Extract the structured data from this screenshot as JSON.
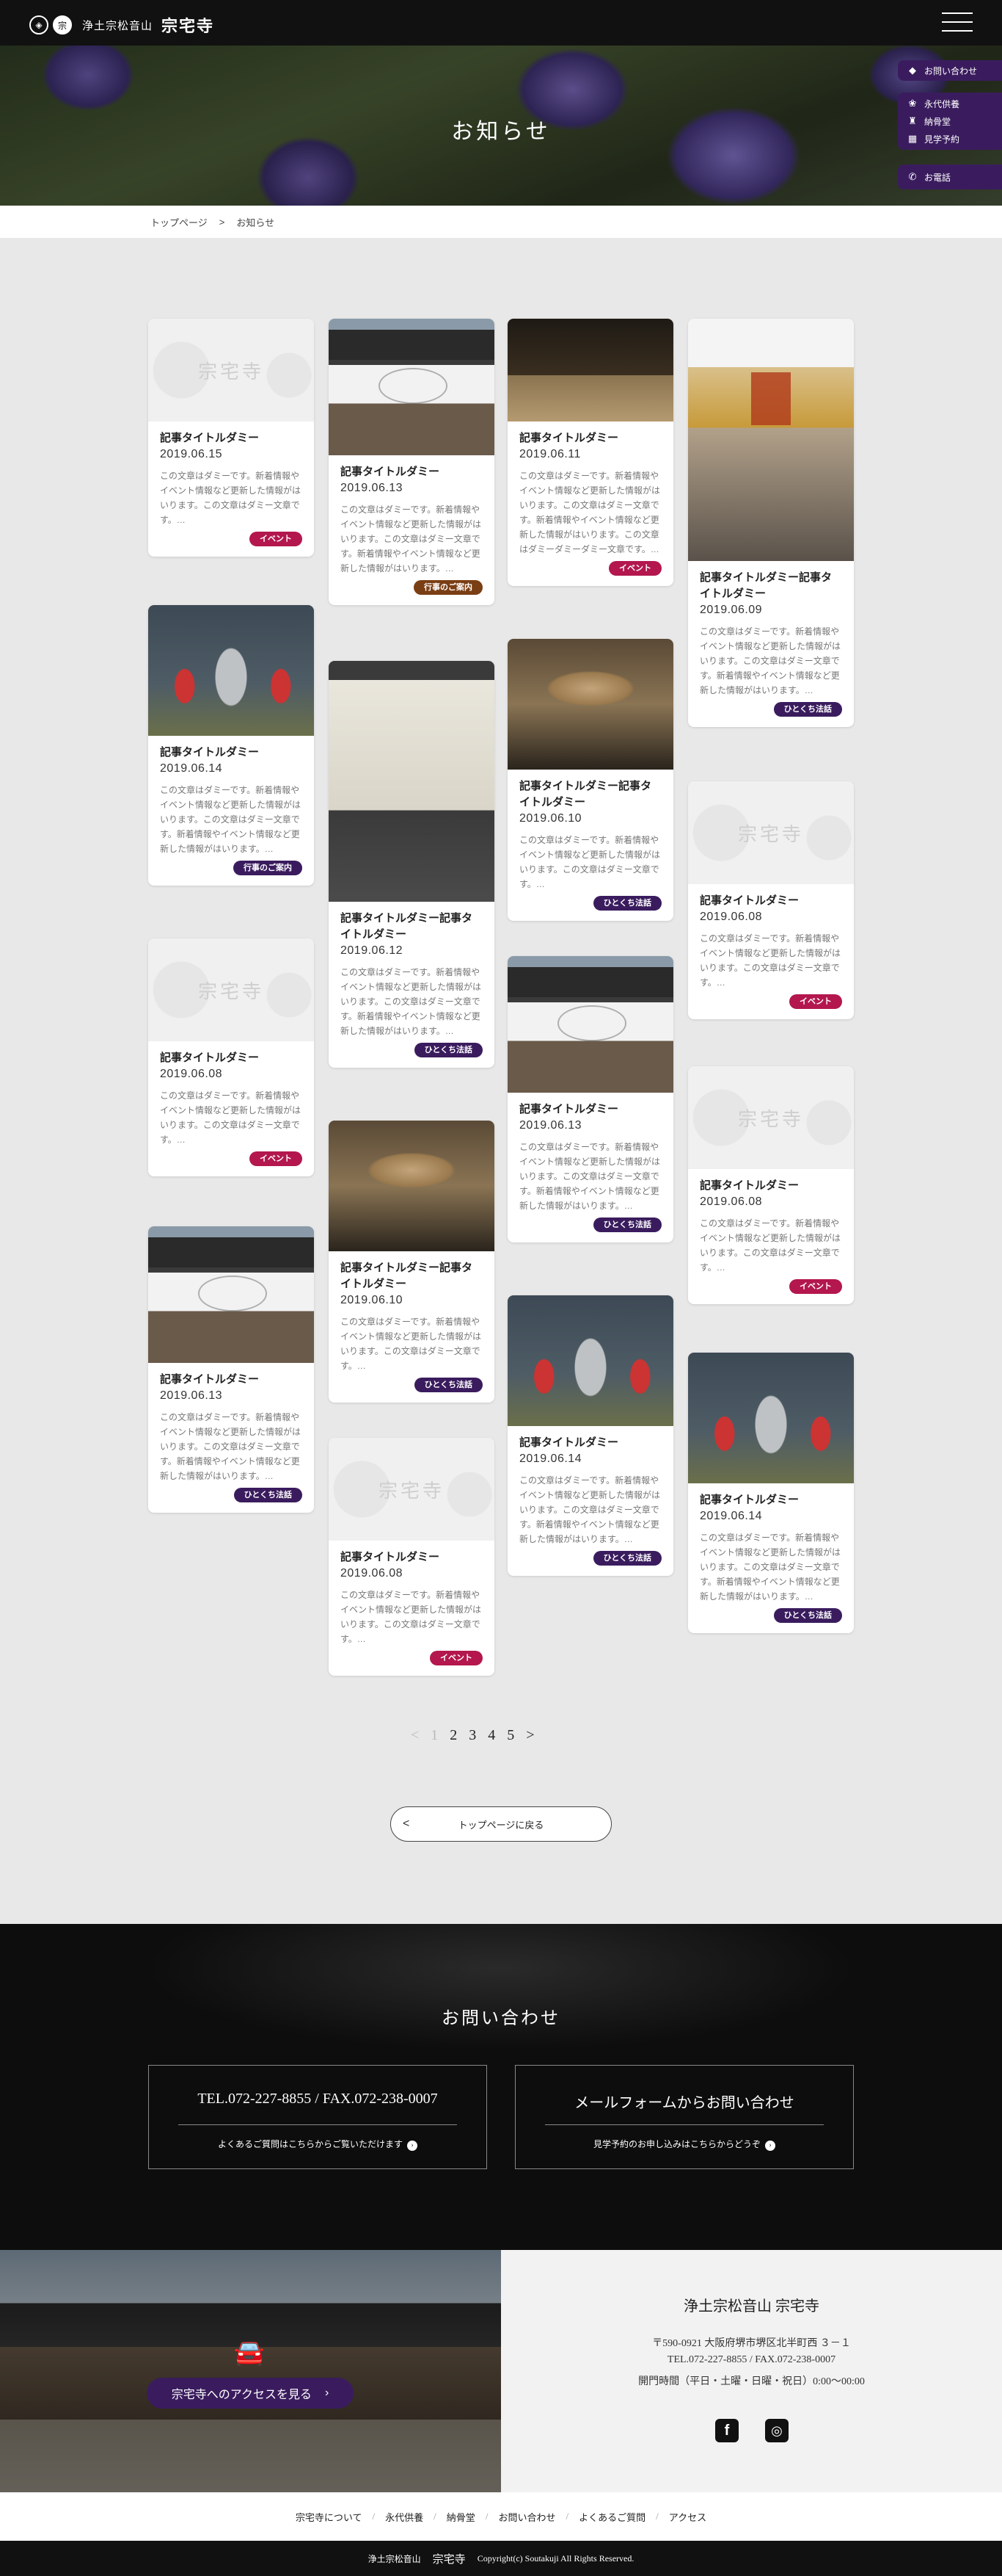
{
  "header": {
    "logo_small": "浄土宗松音山",
    "logo_big": "宗宅寺",
    "crest_text": "宗"
  },
  "side_menu": {
    "contact": "お問い合わせ",
    "items": [
      "永代供養",
      "納骨堂",
      "見学予約"
    ],
    "phone": "お電話"
  },
  "hero": {
    "title": "お知らせ"
  },
  "breadcrumb": {
    "home": "トップページ",
    "sep": ">",
    "current": "お知らせ"
  },
  "thumb_logo_text": "宗宅寺",
  "cards": [
    {
      "title": "記事タイトルダミー",
      "date": "2019.06.15",
      "excerpt": "この文章はダミーです。新着情報やイベント情報など更新した情報がはいります。この文章はダミー文章です。…",
      "tag": "イベント",
      "tag_color": "#b3174d"
    },
    {
      "title": "記事タイトルダミー",
      "date": "2019.06.14",
      "excerpt": "この文章はダミーです。新着情報やイベント情報など更新した情報がはいります。この文章はダミー文章です。新着情報やイベント情報など更新した情報がはいります。…",
      "tag": "行事のご案内",
      "tag_color": "#3a1c5e"
    },
    {
      "title": "記事タイトルダミー",
      "date": "2019.06.08",
      "excerpt": "この文章はダミーです。新着情報やイベント情報など更新した情報がはいります。この文章はダミー文章です。…",
      "tag": "イベント",
      "tag_color": "#b3174d"
    },
    {
      "title": "記事タイトルダミー",
      "date": "2019.06.13",
      "excerpt": "この文章はダミーです。新着情報やイベント情報など更新した情報がはいります。この文章はダミー文章です。新着情報やイベント情報など更新した情報がはいります。…",
      "tag": "ひとくち法話",
      "tag_color": "#3a1c5e"
    },
    {
      "title": "記事タイトルダミー",
      "date": "2019.06.13",
      "excerpt": "この文章はダミーです。新着情報やイベント情報など更新した情報がはいります。この文章はダミー文章です。新着情報やイベント情報など更新した情報がはいります。…",
      "tag": "行事のご案内",
      "tag_color": "#7a3e14"
    },
    {
      "title": "記事タイトルダミー記事タイトルダミー",
      "date": "2019.06.12",
      "excerpt": "この文章はダミーです。新着情報やイベント情報など更新した情報がはいります。この文章はダミー文章です。新着情報やイベント情報など更新した情報がはいります。…",
      "tag": "ひとくち法話",
      "tag_color": "#3a1c5e"
    },
    {
      "title": "記事タイトルダミー記事タイトルダミー",
      "date": "2019.06.10",
      "excerpt": "この文章はダミーです。新着情報やイベント情報など更新した情報がはいります。この文章はダミー文章です。…",
      "tag": "ひとくち法話",
      "tag_color": "#3a1c5e"
    },
    {
      "title": "記事タイトルダミー",
      "date": "2019.06.08",
      "excerpt": "この文章はダミーです。新着情報やイベント情報など更新した情報がはいります。この文章はダミー文章です。…",
      "tag": "イベント",
      "tag_color": "#b3174d"
    },
    {
      "title": "記事タイトルダミー",
      "date": "2019.06.11",
      "excerpt": "この文章はダミーです。新着情報やイベント情報など更新した情報がはいります。この文章はダミー文章です。新着情報やイベント情報など更新した情報がはいります。この文章はダミーダミーダミー文章です。…",
      "tag": "イベント",
      "tag_color": "#b3174d"
    },
    {
      "title": "記事タイトルダミー記事タイトルダミー",
      "date": "2019.06.10",
      "excerpt": "この文章はダミーです。新着情報やイベント情報など更新した情報がはいります。この文章はダミー文章です。…",
      "tag": "ひとくち法話",
      "tag_color": "#3a1c5e"
    },
    {
      "title": "記事タイトルダミー",
      "date": "2019.06.13",
      "excerpt": "この文章はダミーです。新着情報やイベント情報など更新した情報がはいります。この文章はダミー文章です。新着情報やイベント情報など更新した情報がはいります。…",
      "tag": "ひとくち法話",
      "tag_color": "#3a1c5e"
    },
    {
      "title": "記事タイトルダミー",
      "date": "2019.06.14",
      "excerpt": "この文章はダミーです。新着情報やイベント情報など更新した情報がはいります。この文章はダミー文章です。新着情報やイベント情報など更新した情報がはいります。…",
      "tag": "ひとくち法話",
      "tag_color": "#3a1c5e"
    },
    {
      "title": "記事タイトルダミー記事タイトルダミー",
      "date": "2019.06.09",
      "excerpt": "この文章はダミーです。新着情報やイベント情報など更新した情報がはいります。この文章はダミー文章です。新着情報やイベント情報など更新した情報がはいります。…",
      "tag": "ひとくち法話",
      "tag_color": "#3a1c5e"
    },
    {
      "title": "記事タイトルダミー",
      "date": "2019.06.08",
      "excerpt": "この文章はダミーです。新着情報やイベント情報など更新した情報がはいります。この文章はダミー文章です。…",
      "tag": "イベント",
      "tag_color": "#b3174d"
    },
    {
      "title": "記事タイトルダミー",
      "date": "2019.06.08",
      "excerpt": "この文章はダミーです。新着情報やイベント情報など更新した情報がはいります。この文章はダミー文章です。…",
      "tag": "イベント",
      "tag_color": "#b3174d"
    },
    {
      "title": "記事タイトルダミー",
      "date": "2019.06.14",
      "excerpt": "この文章はダミーです。新着情報やイベント情報など更新した情報がはいります。この文章はダミー文章です。新着情報やイベント情報など更新した情報がはいります。…",
      "tag": "ひとくち法話",
      "tag_color": "#3a1c5e"
    }
  ],
  "pagination": {
    "prev": "<",
    "pages": [
      "1",
      "2",
      "3",
      "4",
      "5"
    ],
    "next": ">"
  },
  "back_button": {
    "label": "トップページに戻る",
    "icon": "<"
  },
  "contact": {
    "title": "お問い合わせ",
    "tel_main": "TEL.072-227-8855 / FAX.072-238-0007",
    "tel_sub": "よくあるご質問はこちらからご覧いただけます",
    "mail_main": "メールフォームからお問い合わせ",
    "mail_sub": "見学予約のお申し込みはこちらからどうぞ"
  },
  "access": {
    "button": "宗宅寺へのアクセスを見る",
    "org_small": "浄土宗松音山",
    "org_big": "宗宅寺",
    "address": "〒590-0921 大阪府堺市堺区北半町西 ３－１",
    "tel": "TEL.072-227-8855 / FAX.072-238-0007",
    "hours": "開門時間（平日・土曜・日曜・祝日）0:00〜00:00"
  },
  "footer_nav": [
    "宗宅寺について",
    "永代供養",
    "納骨堂",
    "お問い合わせ",
    "よくあるご質問",
    "アクセス"
  ],
  "copyright": {
    "small": "浄土宗松音山",
    "big": "宗宅寺",
    "text": "Copyright(c) Soutakuji All Rights Reserved."
  }
}
